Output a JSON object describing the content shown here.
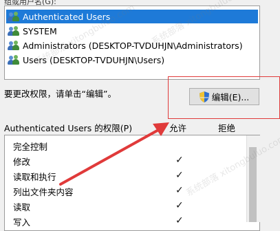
{
  "group_header": "组或用户名(G):",
  "users": [
    {
      "label": "Authenticated Users",
      "selected": true
    },
    {
      "label": "SYSTEM",
      "selected": false
    },
    {
      "label": "Administrators (DESKTOP-TVDUHJN\\Administrators)",
      "selected": false
    },
    {
      "label": "Users (DESKTOP-TVDUHJN\\Users)",
      "selected": false
    }
  ],
  "hint": "要更改权限，请单击“编辑”。",
  "edit_button": "编辑(E)...",
  "permissions_title": "Authenticated Users 的权限(P)",
  "columns": {
    "allow": "允许",
    "deny": "拒绝"
  },
  "permissions": [
    {
      "label": "完全控制",
      "allow": "",
      "deny": ""
    },
    {
      "label": "修改",
      "allow": "✓",
      "deny": ""
    },
    {
      "label": "读取和执行",
      "allow": "✓",
      "deny": ""
    },
    {
      "label": "列出文件夹内容",
      "allow": "✓",
      "deny": ""
    },
    {
      "label": "读取",
      "allow": "✓",
      "deny": ""
    },
    {
      "label": "写入",
      "allow": "✓",
      "deny": ""
    }
  ],
  "watermarks": [
    "系统部落 xitongbuluo.com",
    "系统部落 xitongbuluo.com",
    "系统部落 xitongbuluo.com"
  ],
  "colors": {
    "selection": "#1e7ad8",
    "annotation_red": "#e03a3a"
  }
}
